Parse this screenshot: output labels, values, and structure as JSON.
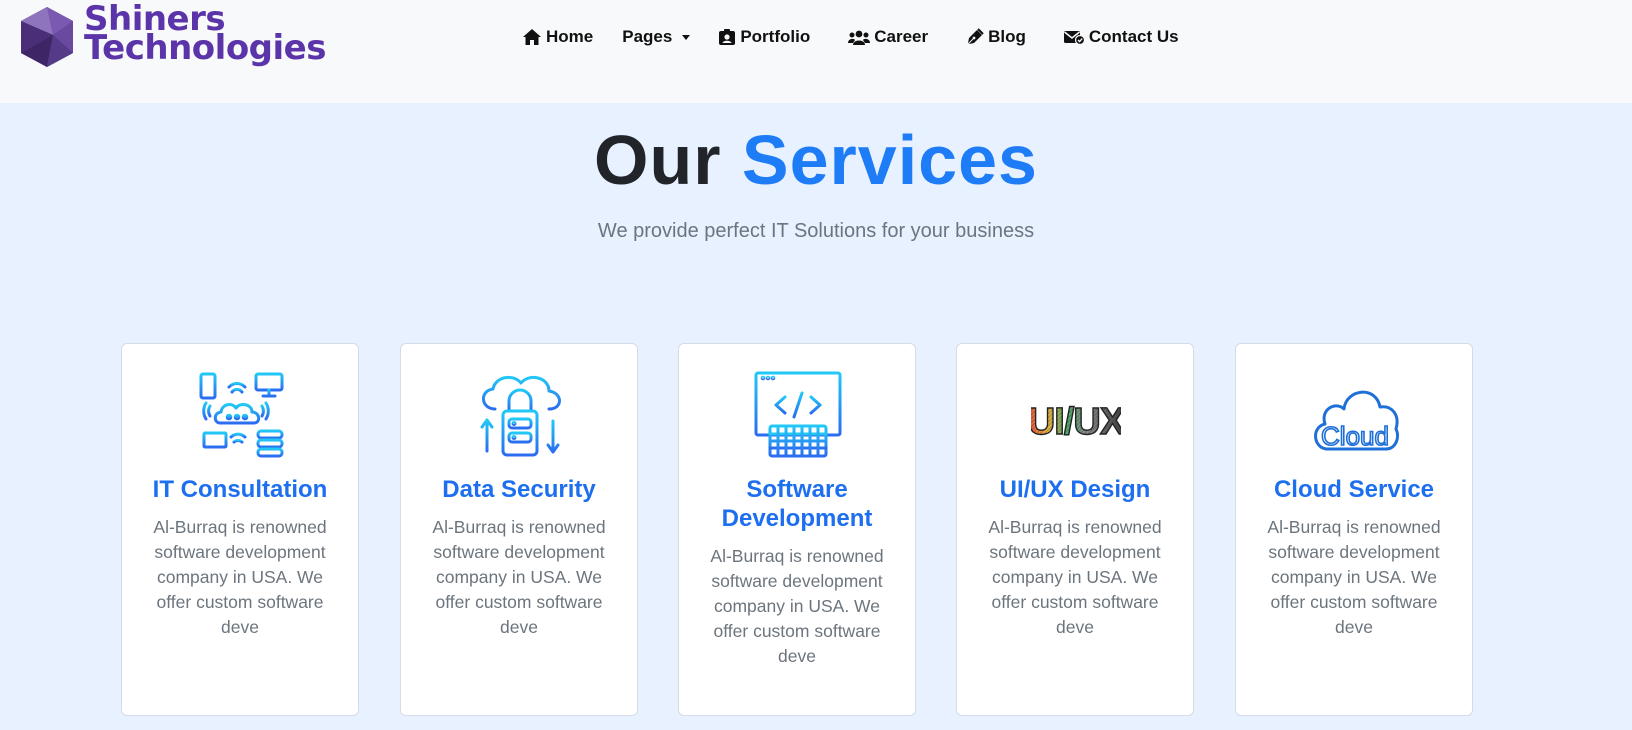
{
  "brand": {
    "line1": "Shiners",
    "line2": "Technologies"
  },
  "nav": {
    "items": [
      {
        "label": "Home",
        "icon": "home-icon"
      },
      {
        "label": "Pages",
        "icon": "caret-down-icon"
      },
      {
        "label": "Portfolio",
        "icon": "id-badge-icon"
      },
      {
        "label": "Career",
        "icon": "users-icon"
      },
      {
        "label": "Blog",
        "icon": "pen-nib-icon"
      },
      {
        "label": "Contact Us",
        "icon": "envelope-icon"
      }
    ]
  },
  "hero": {
    "title_part1": "Our",
    "title_part2": "Services",
    "subtitle": "We provide perfect IT Solutions for your business"
  },
  "colors": {
    "accent": "#1f7cf7",
    "title": "#1d6ff0",
    "brand": "#5a34a8",
    "background": "#e7f1ff"
  },
  "services": [
    {
      "title": "IT Consultation",
      "text": "Al-Burraq is renowned software development company in USA. We offer custom software deve",
      "icon": "network-cloud-icon"
    },
    {
      "title": "Data Security",
      "text": "Al-Burraq is renowned software development company in USA. We offer custom software deve",
      "icon": "cloud-lock-icon"
    },
    {
      "title": "Software Development",
      "text": "Al-Burraq is renowned software development company in USA. We offer custom software deve",
      "icon": "code-keyboard-icon"
    },
    {
      "title": "UI/UX Design",
      "text": "Al-Burraq is renowned software development company in USA. We offer custom software deve",
      "icon": "uiux-icon",
      "icon_text": "UI/UX"
    },
    {
      "title": "Cloud Service",
      "text": "Al-Burraq is renowned software development company in USA. We offer custom software deve",
      "icon": "cloud-icon",
      "icon_text": "Cloud"
    }
  ]
}
